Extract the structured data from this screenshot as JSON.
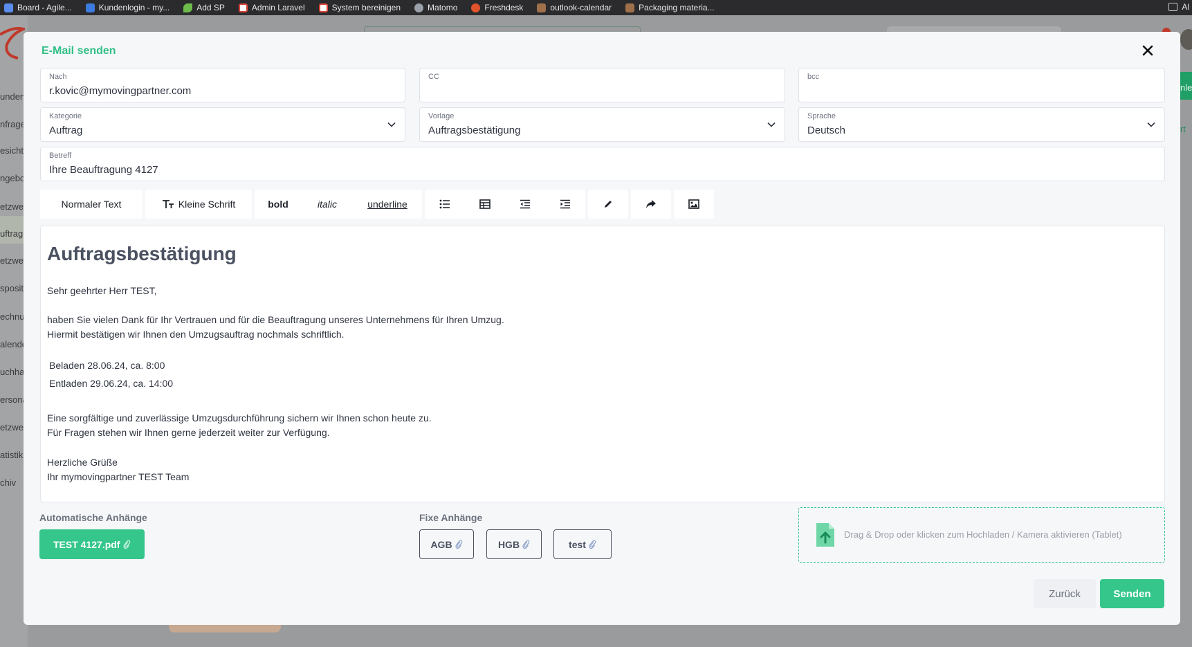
{
  "browser": {
    "bookmarks": [
      {
        "label": "Board - Agile...",
        "color": "#5b8def"
      },
      {
        "label": "Kundenlogin - my...",
        "color": "#3c7be0"
      },
      {
        "label": "Add SP",
        "color": "#6dbb4b"
      },
      {
        "label": "Admin Laravel",
        "color": "#d8463c"
      },
      {
        "label": "System bereinigen",
        "color": "#d8463c"
      },
      {
        "label": "Matomo",
        "color": "#9aa0aa"
      },
      {
        "label": "Freshdesk",
        "color": "#e0532c"
      },
      {
        "label": "outlook-calendar",
        "color": "#a0704a"
      },
      {
        "label": "Packaging materia...",
        "color": "#a0704a"
      }
    ],
    "right_label": "Al"
  },
  "background": {
    "sidebar_items": [
      "unden",
      "nfrage",
      "esicht",
      "ngebo",
      "etzwe",
      "uftrag",
      "etzwe",
      "sposit",
      "echnu",
      "alende",
      "uchha",
      "ersona",
      "etzwe",
      "atistik",
      "chiv"
    ],
    "right_fragments": [
      "nle",
      "rt"
    ]
  },
  "modal": {
    "title": "E-Mail senden",
    "to": {
      "label": "Nach",
      "value": "r.kovic@mymovingpartner.com"
    },
    "cc": {
      "label": "CC",
      "value": ""
    },
    "bcc": {
      "label": "bcc",
      "value": ""
    },
    "category": {
      "label": "Kategorie",
      "value": "Auftrag"
    },
    "template": {
      "label": "Vorlage",
      "value": "Auftragsbestätigung"
    },
    "language": {
      "label": "Sprache",
      "value": "Deutsch"
    },
    "subject": {
      "label": "Betreff",
      "value": "Ihre Beauftragung  4127"
    }
  },
  "toolbar": {
    "normal_text": "Normaler Text",
    "small_text": "Kleine Schrift",
    "bold": "bold",
    "italic": "italic",
    "underline": "underline"
  },
  "editor": {
    "heading": "Auftragsbestätigung",
    "greeting": "Sehr geehrter Herr TEST,",
    "line1": "haben Sie vielen Dank für Ihr Vertrauen und für die Beauftragung unseres Unternehmens für Ihren Umzug.",
    "line2": "Hiermit bestätigen wir Ihnen den Umzugsauftrag nochmals schriftlich.",
    "load": "Beladen  28.06.24, ca. 8:00",
    "unload": "Entladen 29.06.24, ca. 14:00",
    "line3": "Eine sorgfältige und zuverlässige Umzugsdurchführung sichern wir Ihnen schon heute zu.",
    "line4": "Für Fragen stehen wir Ihnen gerne jederzeit weiter zur Verfügung.",
    "closing": "Herzliche Grüße",
    "signature": "Ihr mymovingpartner TEST Team"
  },
  "attachments": {
    "auto_label": "Automatische Anhänge",
    "auto_file": "TEST 4127.pdf",
    "fixed_label": "Fixe Anhänge",
    "fixed": [
      "AGB",
      "HGB",
      "test"
    ],
    "dropzone_text": "Drag & Drop oder klicken zum Hochladen / Kamera aktivieren (Tablet)"
  },
  "actions": {
    "back": "Zurück",
    "send": "Senden"
  },
  "colors": {
    "accent": "#35c68b",
    "title": "#33c087"
  }
}
